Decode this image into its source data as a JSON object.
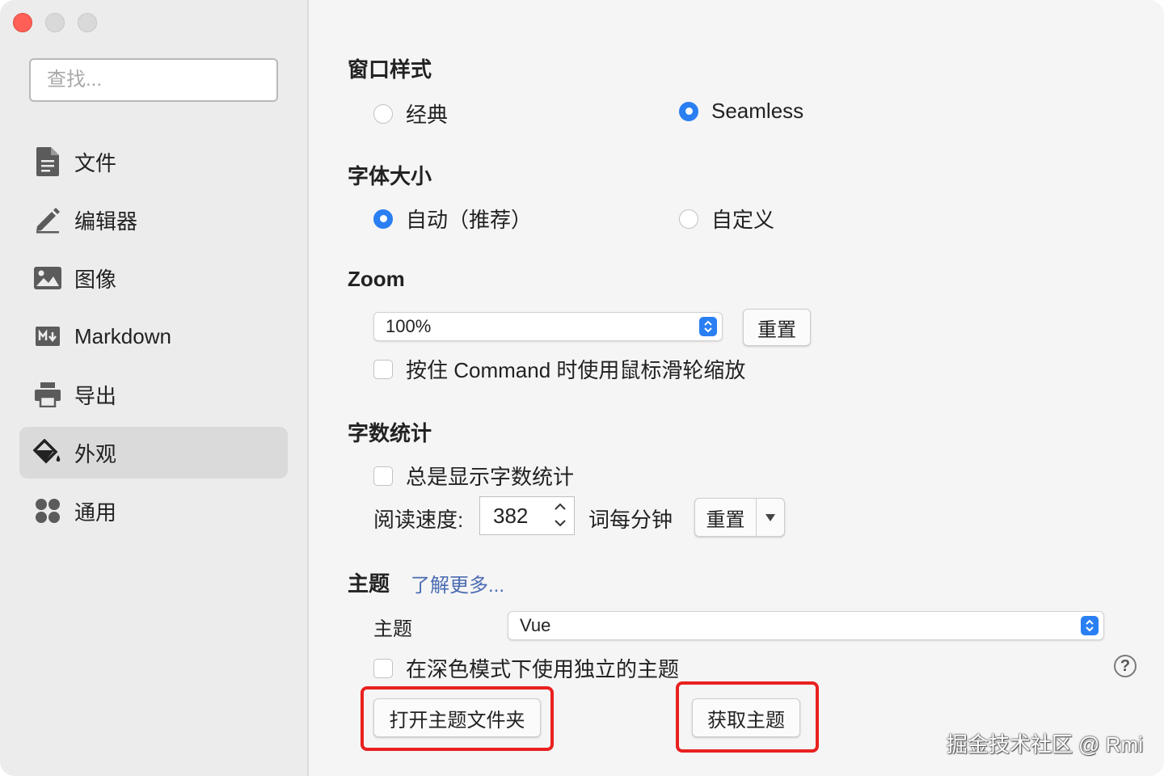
{
  "window": {
    "controls": [
      "close",
      "minimize",
      "maximize"
    ]
  },
  "sidebar": {
    "search_placeholder": "查找...",
    "items": [
      {
        "label": "文件",
        "icon": "file-icon",
        "active": false
      },
      {
        "label": "编辑器",
        "icon": "pencil-icon",
        "active": false
      },
      {
        "label": "图像",
        "icon": "image-icon",
        "active": false
      },
      {
        "label": "Markdown",
        "icon": "markdown-icon",
        "active": false
      },
      {
        "label": "导出",
        "icon": "printer-icon",
        "active": false
      },
      {
        "label": "外观",
        "icon": "paint-bucket-icon",
        "active": true
      },
      {
        "label": "通用",
        "icon": "grid-icon",
        "active": false
      }
    ]
  },
  "window_style": {
    "title": "窗口样式",
    "options": [
      {
        "label": "经典",
        "selected": false
      },
      {
        "label": "Seamless",
        "selected": true
      }
    ]
  },
  "font_size": {
    "title": "字体大小",
    "options": [
      {
        "label": "自动（推荐）",
        "selected": true
      },
      {
        "label": "自定义",
        "selected": false
      }
    ]
  },
  "zoom": {
    "title": "Zoom",
    "value": "100%",
    "reset_label": "重置",
    "command_scroll_label": "按住 Command 时使用鼠标滑轮缩放",
    "command_scroll_checked": false
  },
  "word_count": {
    "title": "字数统计",
    "always_show_label": "总是显示字数统计",
    "always_show_checked": false,
    "reading_speed_label": "阅读速度:",
    "reading_speed_value": "382",
    "unit_label": "词每分钟",
    "reset_label": "重置"
  },
  "theme": {
    "title": "主题",
    "learn_more": "了解更多...",
    "theme_label": "主题",
    "theme_value": "Vue",
    "dark_mode_label": "在深色模式下使用独立的主题",
    "dark_mode_checked": false,
    "open_folder_label": "打开主题文件夹",
    "get_themes_label": "获取主题",
    "help_symbol": "?"
  },
  "watermark": "掘金技术社区 @ Rmi",
  "colors": {
    "accent": "#2a7ff2",
    "highlight": "#e8211f",
    "close": "#fe5f57"
  }
}
